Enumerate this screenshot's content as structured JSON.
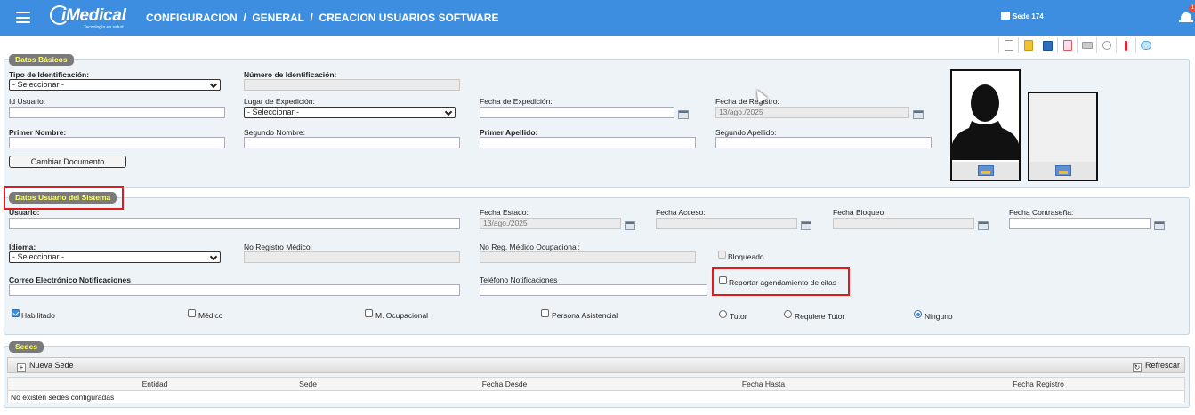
{
  "header": {
    "logo_text": "iMedical",
    "logo_sub": "Tecnología en salud",
    "breadcrumb": "CONFIGURACION  /  GENERAL  /  CREACION USUARIOS SOFTWARE",
    "sede": "Sede 174",
    "notifications_count": "1",
    "colors": {
      "bar": "#3d8ee0",
      "legend_text": "#ffff66",
      "highlight": "#e01b1b"
    }
  },
  "toolbar": {
    "icons": [
      "new-icon",
      "edit-icon",
      "save-icon",
      "delete-icon",
      "print-icon",
      "search-icon",
      "alert-icon",
      "help-icon"
    ]
  },
  "datos_basicos": {
    "legend": "Datos Básicos",
    "tipo_id_label": "Tipo de Identificación:",
    "tipo_id_value": "- Seleccionar -",
    "numero_id_label": "Número de Identificación:",
    "id_usuario_label": "Id Usuario:",
    "lugar_exp_label": "Lugar de Expedición:",
    "lugar_exp_value": "- Seleccionar -",
    "fecha_exp_label": "Fecha de Expedición:",
    "fecha_reg_label": "Fecha de Registro:",
    "fecha_reg_value": "13/ago./2025",
    "primer_nombre_label": "Primer Nombre:",
    "segundo_nombre_label": "Segundo Nombre:",
    "primer_apellido_label": "Primer Apellido:",
    "segundo_apellido_label": "Segundo Apellido:",
    "cambiar_doc_label": "Cambiar Documento"
  },
  "datos_usuario": {
    "legend": "Datos Usuario del Sistema",
    "usuario_label": "Usuario:",
    "fecha_estado_label": "Fecha Estado:",
    "fecha_estado_value": "13/ago./2025",
    "fecha_acceso_label": "Fecha Acceso:",
    "fecha_bloqueo_label": "Fecha Bloqueo",
    "fecha_contrasena_label": "Fecha Contraseña:",
    "idioma_label": "Idioma:",
    "idioma_value": "- Seleccionar -",
    "no_registro_label": "No Registro Médico:",
    "no_reg_ocup_label": "No Reg. Médico Ocupacional:",
    "bloqueado_label": "Bloqueado",
    "correo_label": "Correo Electrónico Notificaciones",
    "telefono_label": "Teléfono Notificaciones",
    "reportar_label": "Reportar agendamiento de citas",
    "habilitado_label": "Habilitado",
    "medico_label": "Médico",
    "m_ocupacional_label": "M. Ocupacional",
    "persona_asist_label": "Persona Asistencial",
    "tutor_label": "Tutor",
    "requiere_tutor_label": "Requiere Tutor",
    "ninguno_label": "Ninguno"
  },
  "sedes": {
    "legend": "Sedes",
    "nueva_sede_label": "Nueva Sede",
    "refrescar_label": "Refrescar",
    "columns": [
      "Entidad",
      "Sede",
      "Fecha Desde",
      "Fecha Hasta",
      "Fecha Registro"
    ],
    "empty_text": "No existen sedes configuradas"
  }
}
